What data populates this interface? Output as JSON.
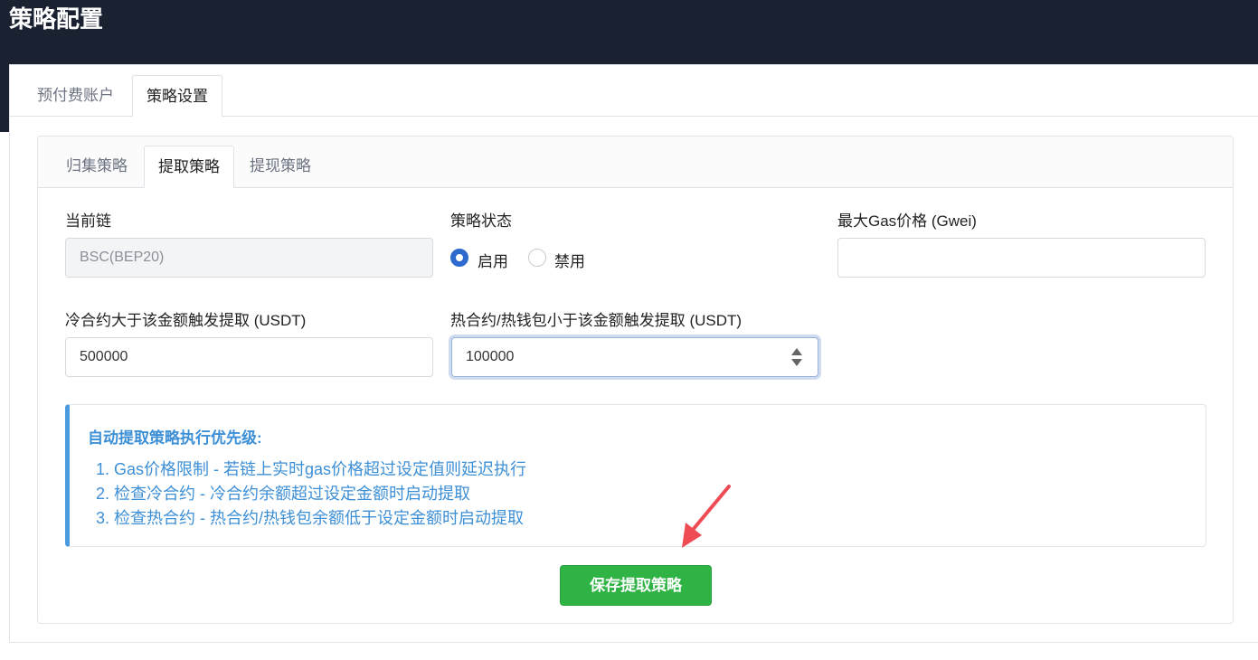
{
  "page": {
    "title": "策略配置"
  },
  "outer_tabs": [
    {
      "label": "预付费账户"
    },
    {
      "label": "策略设置"
    }
  ],
  "inner_tabs": [
    {
      "label": "归集策略"
    },
    {
      "label": "提取策略"
    },
    {
      "label": "提现策略"
    }
  ],
  "form": {
    "chain": {
      "label": "当前链",
      "value": "BSC(BEP20)"
    },
    "status": {
      "label": "策略状态",
      "options": [
        {
          "label": "启用",
          "checked": true
        },
        {
          "label": "禁用",
          "checked": false
        }
      ]
    },
    "gas": {
      "label": "最大Gas价格 (Gwei)",
      "value": ""
    },
    "cold": {
      "label": "冷合约大于该金额触发提取 (USDT)",
      "value": "500000"
    },
    "hot": {
      "label": "热合约/热钱包小于该金额触发提取 (USDT)",
      "value": "100000"
    }
  },
  "alert": {
    "title": "自动提取策略执行优先级:",
    "items": [
      "1. Gas价格限制 - 若链上实时gas价格超过设定值则延迟执行",
      "2. 检查冷合约 - 冷合约余额超过设定金额时启动提取",
      "3. 检查热合约 - 热合约/热钱包余额低于设定金额时启动提取"
    ]
  },
  "actions": {
    "save_label": "保存提取策略"
  },
  "colors": {
    "header_bg": "#1a2232",
    "primary": "#2d6ad0",
    "info": "#3d8fd6",
    "success": "#2fb344",
    "annotation_arrow": "#ef4b55"
  }
}
